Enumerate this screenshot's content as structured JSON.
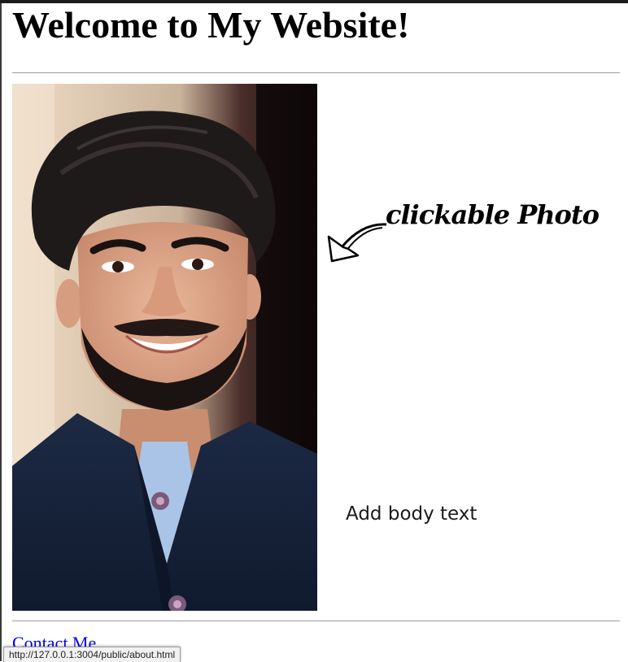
{
  "page": {
    "title": "Welcome to My Website!"
  },
  "photo": {
    "alt": "Portrait photo",
    "annotation": "clickable Photo"
  },
  "body_text": "Add body text",
  "footer": {
    "contact_label": "Contact Me"
  },
  "status_bar": {
    "url": "http://127.0.0.1:3004/public/about.html"
  },
  "colors": {
    "link": "#0000ee",
    "text": "#000000",
    "rule": "#9a9a9a"
  }
}
